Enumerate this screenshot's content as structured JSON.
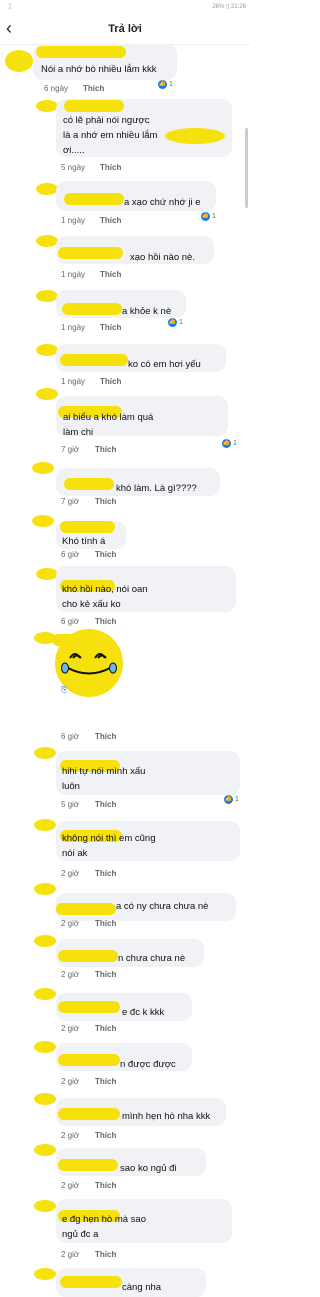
{
  "status": {
    "right": "26% ▯ 21:26"
  },
  "header": {
    "title": "Trả lời",
    "back_icon": "back-arrow-icon"
  },
  "actions": {
    "like_label": "Thích"
  },
  "comments": [
    {
      "text": "Nói a nhớ bò nhiều lắm kkk",
      "time": "6 ngày",
      "reactions": "1"
    },
    {
      "text": "có lẽ phải nói ngược\nlà a nhớ em nhiều lắm\nơi.....",
      "time": "5 ngày",
      "reactions": ""
    },
    {
      "text": "a xạo chứ nhớ ji e",
      "time": "1 ngày",
      "reactions": "1"
    },
    {
      "text": "xạo hồi nào nè.",
      "time": "1 ngày",
      "reactions": ""
    },
    {
      "text": "a khỏe k nè",
      "time": "1 ngày",
      "reactions": "1"
    },
    {
      "text": "ko có em hơi yếu",
      "time": "1 ngày",
      "reactions": ""
    },
    {
      "text": "ai biểu a khó làm quá\nlàm chi",
      "time": "7 giờ",
      "reactions": "1"
    },
    {
      "text": "khó làm. Là gì????",
      "time": "7 giờ",
      "reactions": ""
    },
    {
      "text": "Khó tính á",
      "time": "6 giờ",
      "reactions": ""
    },
    {
      "text": "khó hồi nào, nói oan\ncho kẻ xấu ko",
      "time": "6 giờ",
      "reactions": ""
    },
    {
      "text": "",
      "time": "6 giờ",
      "reactions": ""
    },
    {
      "text": "hihi tự nói mình xấu\nluôn",
      "time": "5 giờ",
      "reactions": "1"
    },
    {
      "text": "không nói thì em cũng\nnói ak",
      "time": "2 giờ",
      "reactions": ""
    },
    {
      "text": "a có ny chưa chưa nè",
      "time": "2 giờ",
      "reactions": ""
    },
    {
      "text": "n chưa chưa nè",
      "time": "2 giờ",
      "reactions": ""
    },
    {
      "text": "e đc k kkk",
      "time": "2 giờ",
      "reactions": ""
    },
    {
      "text": "n được được",
      "time": "2 giờ",
      "reactions": ""
    },
    {
      "text": "mình hẹn hò nha kkk",
      "time": "2 giờ",
      "reactions": ""
    },
    {
      "text": "sao ko ngủ đi",
      "time": "2 giờ",
      "reactions": ""
    },
    {
      "text": "e đg hẹn hò mà sao\nngủ đc a",
      "time": "2 giờ",
      "reactions": ""
    },
    {
      "text": "càng nha",
      "time": "",
      "reactions": ""
    }
  ]
}
